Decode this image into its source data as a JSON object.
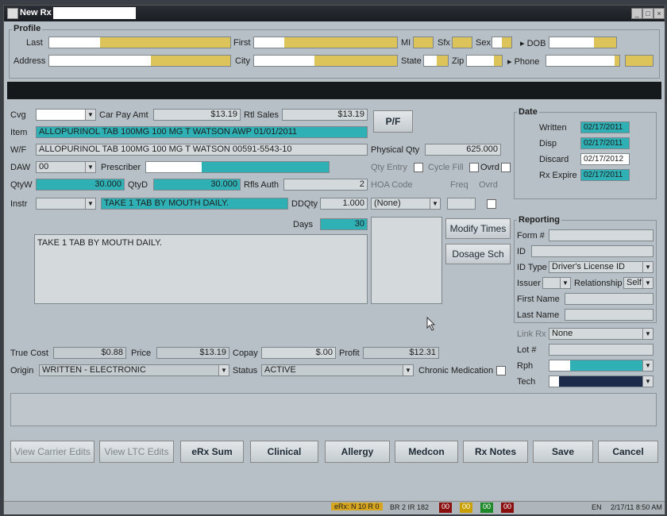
{
  "window": {
    "title": "New Rx"
  },
  "profile": {
    "legend": "Profile",
    "last_label": "Last",
    "first_label": "First",
    "mi_label": "MI",
    "sfx_label": "Sfx",
    "sex_label": "Sex",
    "dob_label": "DOB",
    "address_label": "Address",
    "city_label": "City",
    "state_label": "State",
    "zip_label": "Zip",
    "phone_label": "Phone"
  },
  "rx": {
    "cvg_label": "Cvg",
    "car_pay_amt_label": "Car Pay Amt",
    "car_pay_amt": "$13.19",
    "rtl_sales_label": "Rtl Sales",
    "rtl_sales": "$13.19",
    "item_label": "Item",
    "item_value": "ALLOPURINOL  TAB 100MG 100 MG T WATSON AWP 01/01/2011",
    "wf_label": "W/F",
    "wf_value": "ALLOPURINOL  TAB 100MG 100 MG T WATSON 00591-5543-10",
    "daw_label": "DAW",
    "daw_value": "00",
    "prescriber_label": "Prescriber",
    "qtyw_label": "QtyW",
    "qtyw": "30.000",
    "qtyd_label": "QtyD",
    "qtyd": "30.000",
    "rfls_auth_label": "Rfls Auth",
    "rfls_auth": "2",
    "instr_label": "Instr",
    "instr_code": "TAKE 1 TAB BY MOUTH DAILY.",
    "ddqty_label": "DDQty",
    "ddqty": "1.000",
    "days_label": "Days",
    "days": "30",
    "instr_text": "TAKE 1 TAB BY MOUTH DAILY.",
    "pf_button": "P/F",
    "physical_qty_label": "Physical Qty",
    "physical_qty": "625.000",
    "qty_entry_label": "Qty Entry",
    "cycle_fill_label": "Cycle Fill",
    "ovrd_label": "Ovrd",
    "hoa_code_label": "HOA Code",
    "freq_label": "Freq",
    "ovrd2_label": "Ovrd",
    "hoa_value": "(None)",
    "modify_times_button": "Modify Times",
    "dosage_sch_button": "Dosage Sch"
  },
  "date": {
    "legend": "Date",
    "written_label": "Written",
    "written": "02/17/2011",
    "disp_label": "Disp",
    "disp": "02/17/2011",
    "discard_label": "Discard",
    "discard": "02/17/2012",
    "rx_expire_label": "Rx Expire",
    "rx_expire": "02/17/2011"
  },
  "reporting": {
    "legend": "Reporting",
    "form_label": "Form #",
    "id_label": "ID",
    "id_type_label": "ID Type",
    "id_type": "Driver's License ID",
    "issuer_label": "Issuer",
    "relationship_label": "Relationship",
    "relationship": "Self",
    "first_name_label": "First Name",
    "last_name_label": "Last Name"
  },
  "side": {
    "link_rx_label": "Link Rx",
    "link_rx": "None",
    "lot_label": "Lot #",
    "rph_label": "Rph",
    "tech_label": "Tech"
  },
  "pricing": {
    "true_cost_label": "True Cost",
    "true_cost": "$0.88",
    "price_label": "Price",
    "price": "$13.19",
    "copay_label": "Copay",
    "copay": "$.00",
    "profit_label": "Profit",
    "profit": "$12.31",
    "origin_label": "Origin",
    "origin": "WRITTEN - ELECTRONIC",
    "status_label": "Status",
    "status": "ACTIVE",
    "chronic_label": "Chronic Medication"
  },
  "buttons": {
    "view_carrier_edits": "View Carrier Edits",
    "view_ltc_edits": "View LTC Edits",
    "erx_sum": "eRx Sum",
    "clinical": "Clinical",
    "allergy": "Allergy",
    "medcon": "Medcon",
    "rx_notes": "Rx Notes",
    "save": "Save",
    "cancel": "Cancel"
  },
  "statusbar": {
    "erx": "eRx: N 10 R 0",
    "br": "BR 2 IR 182",
    "counters": [
      "00",
      "00",
      "00",
      "00"
    ],
    "lang": "EN",
    "datetime": "2/17/11 8:50 AM"
  },
  "colors": {
    "field_yellow": "#dcc35a",
    "field_teal": "#2fb0b4",
    "title_bar": "#1a1d22"
  }
}
